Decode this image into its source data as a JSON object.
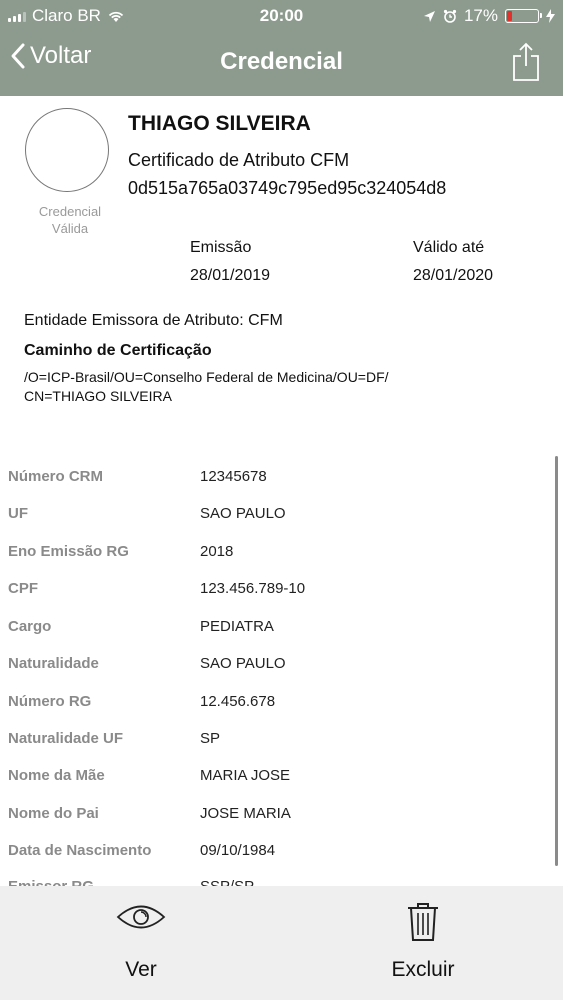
{
  "status_bar": {
    "carrier": "Claro BR",
    "time": "20:00",
    "battery_percent": "17%",
    "battery_level": 0.17,
    "battery_color": "#e0312d"
  },
  "nav": {
    "back_label": "Voltar",
    "title": "Credencial",
    "bar_color": "#8d9b8e"
  },
  "credential": {
    "status_line1": "Credencial",
    "status_line2": "Válida",
    "name": "THIAGO SILVEIRA",
    "certificate_type": "Certificado de Atributo CFM",
    "hash": "0d515a765a03749c795ed95c324054d8",
    "issue_label": "Emissão",
    "issue_date": "28/01/2019",
    "valid_label": "Válido até",
    "valid_date": "28/01/2020",
    "issuer_entity": "Entidade Emissora de Atributo: CFM",
    "cert_path_title": "Caminho de Certificação",
    "cert_path_line1": "/O=ICP-Brasil/OU=Conselho Federal de Medicina/OU=DF/",
    "cert_path_line2": "CN=THIAGO SILVEIRA"
  },
  "fields": [
    {
      "label": "Número CRM",
      "value": "12345678"
    },
    {
      "label": "UF",
      "value": "SAO PAULO"
    },
    {
      "label": "Eno Emissão RG",
      "value": "2018"
    },
    {
      "label": "CPF",
      "value": "123.456.789-10"
    },
    {
      "label": "Cargo",
      "value": "PEDIATRA"
    },
    {
      "label": "Naturalidade",
      "value": "SAO PAULO"
    },
    {
      "label": "Número RG",
      "value": "12.456.678"
    },
    {
      "label": "Naturalidade UF",
      "value": "SP"
    },
    {
      "label": "Nome da Mãe",
      "value": "MARIA JOSE"
    },
    {
      "label": "Nome do Pai",
      "value": "JOSE MARIA"
    },
    {
      "label": "Data de Nascimento",
      "value": "09/10/1984"
    },
    {
      "label": "Emissor RG",
      "value": "SSP/SP"
    }
  ],
  "bottom_bar": {
    "view_label": "Ver",
    "delete_label": "Excluir"
  },
  "icons": [
    "back-chevron-icon",
    "share-icon",
    "eye-icon",
    "trash-icon",
    "wifi-icon",
    "location-icon",
    "alarm-icon",
    "charging-icon"
  ]
}
